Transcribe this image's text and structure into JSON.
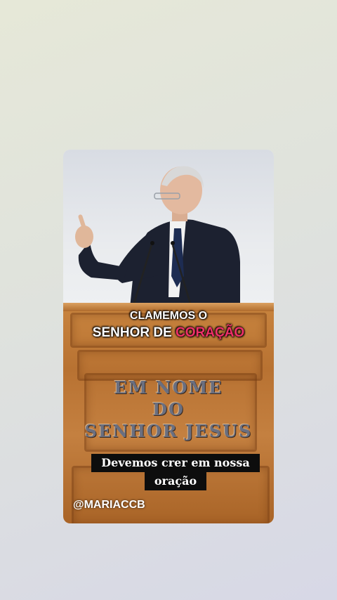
{
  "video": {
    "caption_line1": "CLAMEMOS O",
    "caption_line2_a": "SENHOR DE ",
    "caption_line2_b": "CORAÇÃO",
    "pulpit_line1": "EM NOME",
    "pulpit_line2": "DO",
    "pulpit_line3": "SENHOR JESUS",
    "subtitle_line1": "Devemos crer em nossa",
    "subtitle_line2": "oração",
    "watermark": "@MARIACCB"
  },
  "colors": {
    "highlight": "#f0306a",
    "subtitle_bg": "#0d0d0d",
    "wood": "#b87232"
  }
}
